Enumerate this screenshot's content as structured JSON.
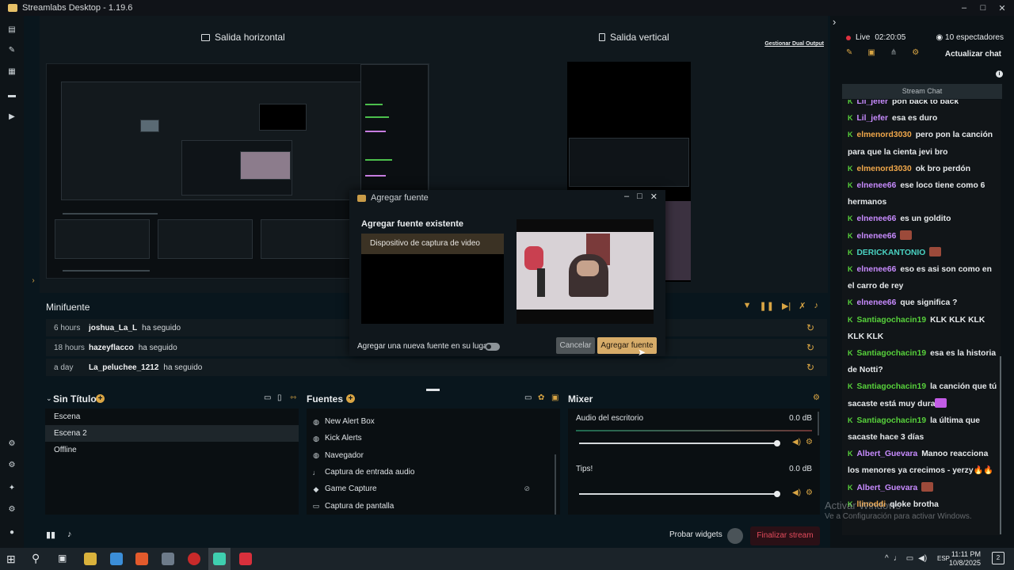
{
  "window": {
    "title": "Streamlabs Desktop - 1.19.6",
    "controls": [
      "–",
      "□",
      "✕"
    ]
  },
  "stage": {
    "horizontal_label": "Salida horizontal",
    "vertical_label": "Salida vertical",
    "manage_dual": "Gestionar Dual Output"
  },
  "minifuente": {
    "title": "Minifuente",
    "rows": [
      {
        "time": "6 hours",
        "user": "joshua_La_L",
        "action": "ha seguido"
      },
      {
        "time": "18 hours",
        "user": "hazeyflacco",
        "action": "ha seguido"
      },
      {
        "time": "a day",
        "user": "La_peluchee_1212",
        "action": "ha seguido"
      }
    ]
  },
  "scenes": {
    "title": "Sin Título",
    "items": [
      "Escena",
      "Escena 2",
      "Offline"
    ],
    "selected": "Escena 2"
  },
  "sources": {
    "title": "Fuentes",
    "items": [
      {
        "label": "New Alert Box",
        "icon": "globe-icon"
      },
      {
        "label": "Kick Alerts",
        "icon": "globe-icon"
      },
      {
        "label": "Navegador",
        "icon": "globe-icon"
      },
      {
        "label": "Captura de entrada audio",
        "icon": "mic-icon"
      },
      {
        "label": "Game Capture",
        "icon": "gamepad-icon"
      },
      {
        "label": "Captura de pantalla",
        "icon": "monitor-icon"
      }
    ]
  },
  "mixer": {
    "title": "Mixer",
    "channels": [
      {
        "name": "Audio del escritorio",
        "db": "0.0 dB",
        "level": 0.96
      },
      {
        "name": "Tips!",
        "db": "0.0 dB",
        "level": 0.96
      }
    ]
  },
  "footer": {
    "probar_widgets": "Probar widgets",
    "finalizar_stream": "Finalizar stream"
  },
  "dialog": {
    "title": "Agregar fuente",
    "section": "Agregar fuente existente",
    "existing_sources": [
      "Dispositivo de captura de video"
    ],
    "replace_label": "Agregar una nueva fuente en su lugar",
    "replace_enabled": false,
    "cancel": "Cancelar",
    "add": "Agregar fuente"
  },
  "chat_panel": {
    "live_label": "Live",
    "live_time": "02:20:05",
    "viewers": "10 espectadores",
    "refresh_chat": "Actualizar chat",
    "stream_chat": "Stream Chat",
    "messages": [
      {
        "user": "Lil_jefer",
        "color": "purple",
        "text": "pon back to back"
      },
      {
        "user": "Lil_jefer",
        "color": "purple",
        "text": "esa es duro"
      },
      {
        "user": "elmenord3030",
        "color": "orange",
        "text": "pero pon la canción para que la cienta jevi bro"
      },
      {
        "user": "elmenord3030",
        "color": "orange",
        "text": "ok bro perdón"
      },
      {
        "user": "elnenee66",
        "color": "purple",
        "text": "ese loco tiene como 6 hermanos"
      },
      {
        "user": "elnenee66",
        "color": "purple",
        "text": "es un goldito"
      },
      {
        "user": "elnenee66",
        "color": "purple",
        "text": "",
        "emote": true
      },
      {
        "user": "DERICKANTONIO",
        "color": "teal",
        "text": "",
        "emote": true
      },
      {
        "user": "elnenee66",
        "color": "purple",
        "text": "eso es asi son como en el carro de rey"
      },
      {
        "user": "elnenee66",
        "color": "purple",
        "text": "que significa ?"
      },
      {
        "user": "Santiagochacin19",
        "color": "green",
        "text": "KLK KLK KLK KLK KLK"
      },
      {
        "user": "Santiagochacin19",
        "color": "green",
        "text": "esa es la historia de Notti?"
      },
      {
        "user": "Santiagochacin19",
        "color": "green",
        "text": "la canción que tú sacaste está muy dura",
        "emote_pink": true
      },
      {
        "user": "Santiagochacin19",
        "color": "green",
        "text": "la última que sacaste hace 3 días"
      },
      {
        "user": "Albert_Guevara",
        "color": "purple",
        "text": "Manoo reacciona los menores ya crecimos - yerzy🔥🔥"
      },
      {
        "user": "Albert_Guevara",
        "color": "purple",
        "text": "",
        "emote": true
      },
      {
        "user": "llinoddi",
        "color": "orange",
        "text": "qloke brotha"
      }
    ]
  },
  "watermark": {
    "line1": "Activar Windows",
    "line2": "Ve a Configuración para activar Windows."
  },
  "taskbar": {
    "time": "11:11 PM",
    "date": "10/8/2025",
    "lang": "ESP"
  },
  "colors": {
    "accent": "#d9a544",
    "live_red": "#e0313f",
    "end_stream": "#e44b5c",
    "chat_kick_green": "#57d13b"
  }
}
